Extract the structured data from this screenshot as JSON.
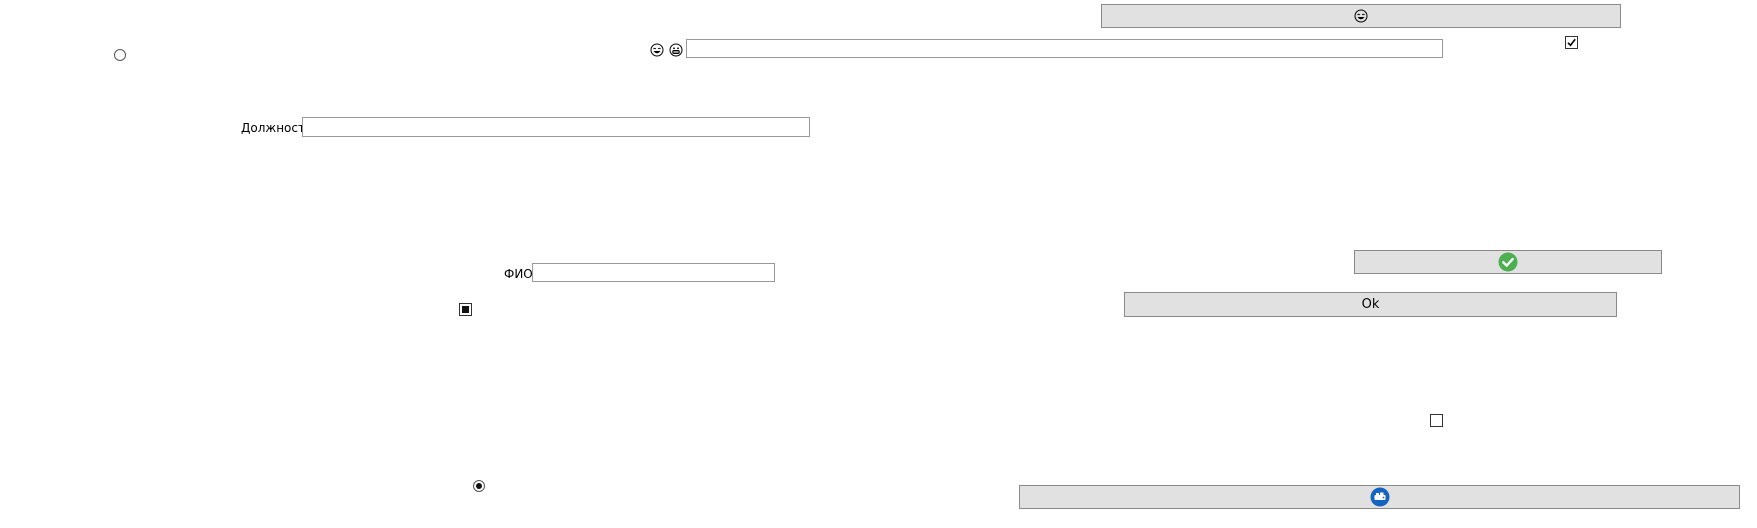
{
  "form": {
    "position_label": "Должность",
    "position_value": "",
    "fio_label": "ФИО",
    "fio_value": "",
    "top_text_value": "",
    "ok_label": "Ok"
  },
  "buttons": {
    "top_icon": "laughing-face-icon",
    "check_icon": "green-check-icon",
    "bottom_icon": "blue-round-logo-icon"
  },
  "controls": {
    "checkbox_top_checked": true,
    "checkbox_mid_state": "indeterminate",
    "checkbox_right_checked": false,
    "radio_top_selected": false,
    "radio_bottom_selected": true
  },
  "colors": {
    "button_face": "#e1e1e1",
    "check_green": "#4caf50",
    "logo_blue": "#1565c0"
  }
}
